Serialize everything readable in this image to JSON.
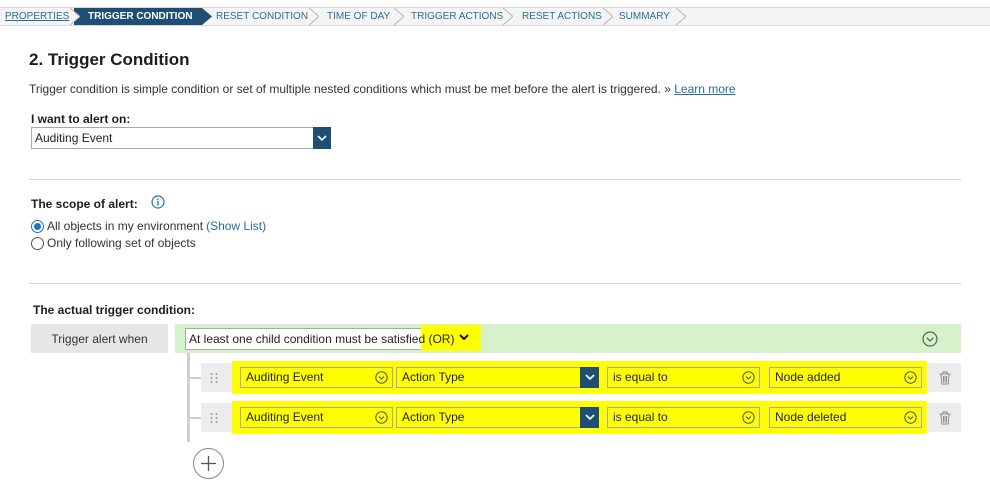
{
  "wizard": {
    "steps": [
      {
        "label": "PROPERTIES",
        "state": "visited"
      },
      {
        "label": "TRIGGER CONDITION",
        "state": "active"
      },
      {
        "label": "RESET CONDITION",
        "state": "pending"
      },
      {
        "label": "TIME OF DAY",
        "state": "pending"
      },
      {
        "label": "TRIGGER ACTIONS",
        "state": "pending"
      },
      {
        "label": "RESET ACTIONS",
        "state": "pending"
      },
      {
        "label": "SUMMARY",
        "state": "pending"
      }
    ]
  },
  "page": {
    "title": "2. Trigger Condition",
    "description": "Trigger condition is simple condition or set of multiple nested conditions which must be met before the alert is triggered. » ",
    "learn_more": "Learn more"
  },
  "alert_on": {
    "label": "I want to alert on:",
    "value": "Auditing Event"
  },
  "scope": {
    "label": "The scope of alert:",
    "options": [
      {
        "label": "All objects in my environment",
        "selected": true,
        "link": "(Show List)"
      },
      {
        "label": "Only following set of objects",
        "selected": false
      }
    ]
  },
  "trigger": {
    "label": "The actual trigger condition:",
    "when_label": "Trigger alert when",
    "group_operator": "At least one child condition must be satisfied (OR)",
    "conditions": [
      {
        "source": "Auditing Event",
        "property": "Action Type",
        "operator": "is equal to",
        "value": "Node added"
      },
      {
        "source": "Auditing Event",
        "property": "Action Type",
        "operator": "is equal to",
        "value": "Node deleted"
      }
    ]
  },
  "colors": {
    "accent": "#1e4e73",
    "link": "#2a6e96",
    "group_bg": "#d6f2cc",
    "highlight": "#ffff00"
  },
  "icons": [
    "chevron-down-icon",
    "info-icon",
    "collapse-icon",
    "drag-handle-icon",
    "trash-icon",
    "plus-icon"
  ]
}
